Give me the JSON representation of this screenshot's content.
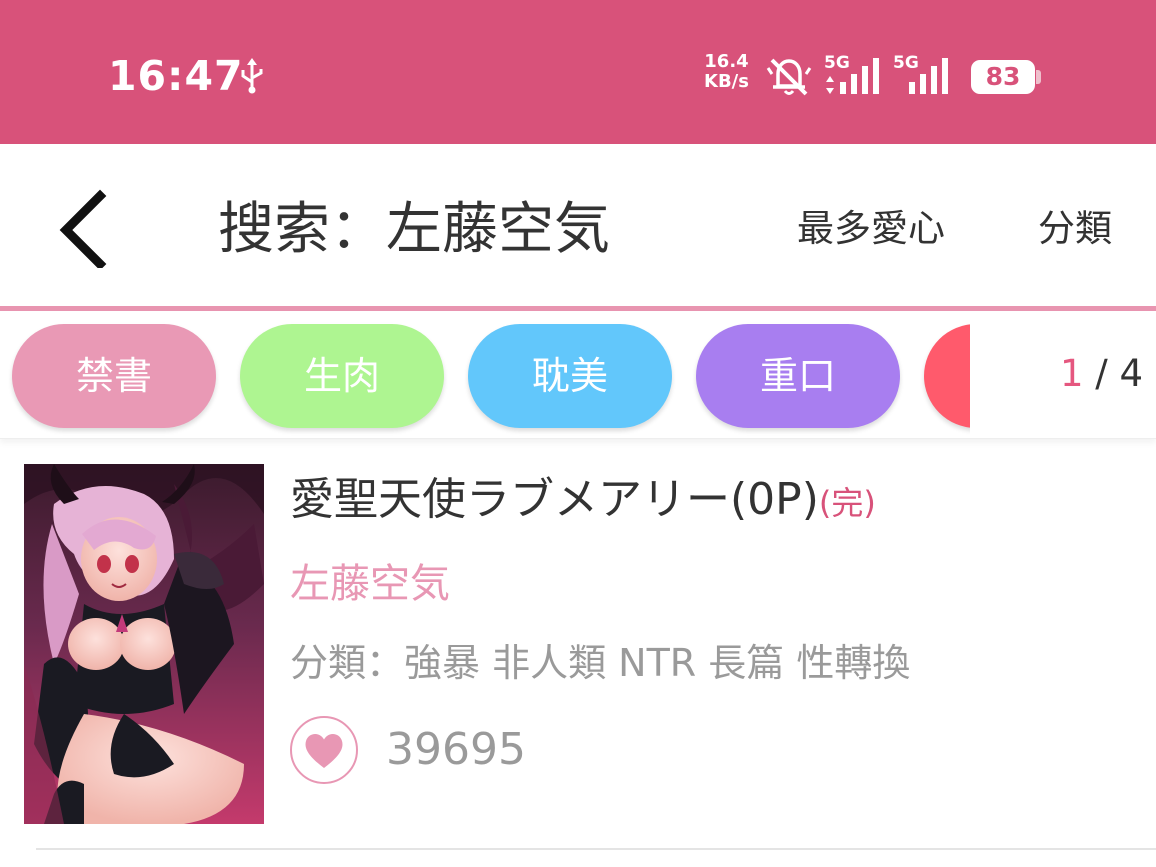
{
  "status_bar": {
    "time": "16:47",
    "net_speed_value": "16.4",
    "net_speed_unit": "KB/s",
    "sim1_label": "5G",
    "sim2_label": "5G",
    "battery": "83",
    "bg_color": "#d8527a"
  },
  "header": {
    "title_prefix": "搜索：",
    "title_query": "左藤空気",
    "sort_label": "最多愛心",
    "category_label": "分類",
    "accent_color": "#e895b0"
  },
  "tags": {
    "items": [
      {
        "label": "禁書",
        "color": "#e999b5"
      },
      {
        "label": "生肉",
        "color": "#aef591"
      },
      {
        "label": "耽美",
        "color": "#62c7fb"
      },
      {
        "label": "重口",
        "color": "#a87ef0"
      },
      {
        "label": "",
        "color": "#ff5a6c"
      }
    ],
    "page_current": "1",
    "page_sep": " / ",
    "page_total": "4"
  },
  "results": [
    {
      "title": "愛聖天使ラブメアリー(0P)",
      "status": "(完)",
      "author": "左藤空気",
      "categories": "分類：強暴 非人類 NTR 長篇 性轉換",
      "likes": "39695"
    }
  ]
}
